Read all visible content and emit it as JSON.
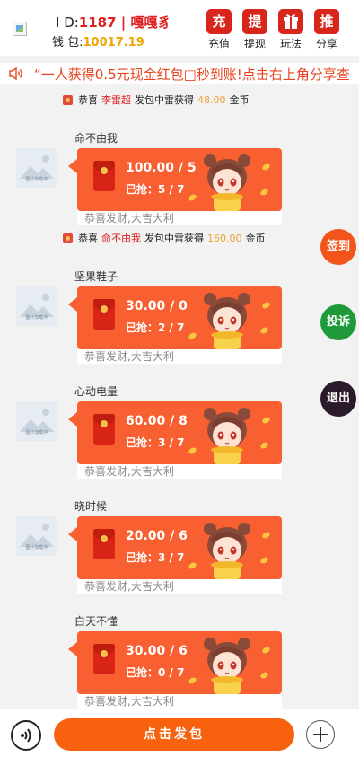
{
  "header": {
    "id_label": "I  D:",
    "id_value": "1187",
    "separator": " | ",
    "nickname": "嘎嘎豸",
    "balance_label": "钱 包:",
    "balance_value": "10017.19",
    "buttons": [
      {
        "icon_char": "充",
        "label": "充值",
        "color": "#d9261c"
      },
      {
        "icon_char": "提",
        "label": "提现",
        "color": "#d9261c"
      },
      {
        "icon_char": "gift-icon",
        "label": "玩法",
        "color": "#d9261c"
      },
      {
        "icon_char": "推",
        "label": "分享",
        "color": "#d9261c"
      }
    ]
  },
  "marquee": {
    "text": "“一人获得0.5元现金红包□秒到账!点击右上角分享查"
  },
  "notices": [
    {
      "prefix": "恭喜",
      "name": "李雷超",
      "middle": "发包中雷获得",
      "amount": "48.00",
      "unit": "金币"
    },
    {
      "prefix": "恭喜",
      "name": "命不由我",
      "middle": "发包中雷获得",
      "amount": "160.00",
      "unit": "金币"
    }
  ],
  "messages": [
    {
      "name": "命不由我",
      "amount": "100.00 / 5",
      "grabbed": "已抢：5 / 7",
      "blessing": "恭喜发财,大吉大利"
    },
    {
      "name": "坚果鞋子",
      "amount": "30.00 / 0",
      "grabbed": "已抢：2 / 7",
      "blessing": "恭喜发财,大吉大利"
    },
    {
      "name": "心动电量",
      "amount": "60.00 / 8",
      "grabbed": "已抢：3 / 7",
      "blessing": "恭喜发财,大吉大利"
    },
    {
      "name": "晓时候",
      "amount": "20.00 / 6",
      "grabbed": "已抢：3 / 7",
      "blessing": "恭喜发财,大吉大利"
    },
    {
      "name": "白天不懂",
      "amount": "30.00 / 6",
      "grabbed": "已抢：0 / 7",
      "blessing": "恭喜发财,大吉大利"
    }
  ],
  "avatar_placeholder_text": "图片加载中",
  "side_buttons": [
    {
      "label": "签到",
      "color": "#f2541c"
    },
    {
      "label": "投诉",
      "color": "#1f9a3a"
    },
    {
      "label": "退出",
      "color": "#2a1a2a"
    }
  ],
  "bottom": {
    "send_label": "点击发包"
  }
}
